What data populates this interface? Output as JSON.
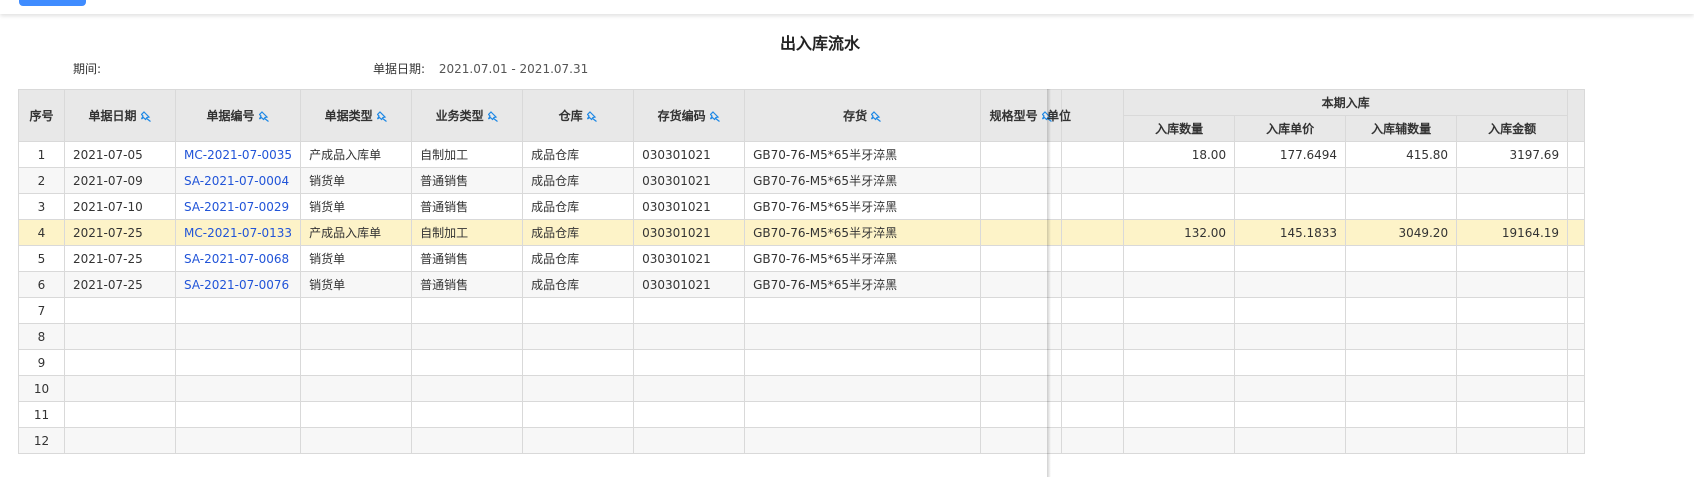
{
  "report": {
    "title": "出入库流水",
    "period_label": "期间:",
    "period_value": "",
    "date_label": "单据日期:",
    "date_value": "2021.07.01 - 2021.07.31"
  },
  "table": {
    "headers": {
      "index": "序号",
      "doc_date": "单据日期",
      "doc_no": "单据编号",
      "doc_type": "单据类型",
      "biz_type": "业务类型",
      "warehouse": "仓库",
      "item_code": "存货编码",
      "item": "存货",
      "spec": "规格型号",
      "unit": "单位",
      "inbound_group": "本期入库",
      "in_qty": "入库数量",
      "in_price": "入库单价",
      "in_aux_qty": "入库辅数量",
      "in_amount": "入库金额"
    },
    "rows": [
      {
        "idx": "1",
        "date": "2021-07-05",
        "no": "MC-2021-07-0035",
        "type": "产成品入库单",
        "biz": "自制加工",
        "wh": "成品仓库",
        "code": "030301021",
        "item": "GB70-76-M5*65半牙淬黑",
        "spec": "",
        "qty": "18.00",
        "price": "177.6494",
        "aux": "415.80",
        "amount": "3197.69"
      },
      {
        "idx": "2",
        "date": "2021-07-09",
        "no": "SA-2021-07-0004",
        "type": "销货单",
        "biz": "普通销售",
        "wh": "成品仓库",
        "code": "030301021",
        "item": "GB70-76-M5*65半牙淬黑",
        "spec": "",
        "qty": "",
        "price": "",
        "aux": "",
        "amount": ""
      },
      {
        "idx": "3",
        "date": "2021-07-10",
        "no": "SA-2021-07-0029",
        "type": "销货单",
        "biz": "普通销售",
        "wh": "成品仓库",
        "code": "030301021",
        "item": "GB70-76-M5*65半牙淬黑",
        "spec": "",
        "qty": "",
        "price": "",
        "aux": "",
        "amount": ""
      },
      {
        "idx": "4",
        "date": "2021-07-25",
        "no": "MC-2021-07-0133",
        "type": "产成品入库单",
        "biz": "自制加工",
        "wh": "成品仓库",
        "code": "030301021",
        "item": "GB70-76-M5*65半牙淬黑",
        "spec": "",
        "qty": "132.00",
        "price": "145.1833",
        "aux": "3049.20",
        "amount": "19164.19"
      },
      {
        "idx": "5",
        "date": "2021-07-25",
        "no": "SA-2021-07-0068",
        "type": "销货单",
        "biz": "普通销售",
        "wh": "成品仓库",
        "code": "030301021",
        "item": "GB70-76-M5*65半牙淬黑",
        "spec": "",
        "qty": "",
        "price": "",
        "aux": "",
        "amount": ""
      },
      {
        "idx": "6",
        "date": "2021-07-25",
        "no": "SA-2021-07-0076",
        "type": "销货单",
        "biz": "普通销售",
        "wh": "成品仓库",
        "code": "030301021",
        "item": "GB70-76-M5*65半牙淬黑",
        "spec": "",
        "qty": "",
        "price": "",
        "aux": "",
        "amount": ""
      },
      {
        "idx": "7",
        "date": "",
        "no": "",
        "type": "",
        "biz": "",
        "wh": "",
        "code": "",
        "item": "",
        "spec": "",
        "qty": "",
        "price": "",
        "aux": "",
        "amount": ""
      },
      {
        "idx": "8",
        "date": "",
        "no": "",
        "type": "",
        "biz": "",
        "wh": "",
        "code": "",
        "item": "",
        "spec": "",
        "qty": "",
        "price": "",
        "aux": "",
        "amount": ""
      },
      {
        "idx": "9",
        "date": "",
        "no": "",
        "type": "",
        "biz": "",
        "wh": "",
        "code": "",
        "item": "",
        "spec": "",
        "qty": "",
        "price": "",
        "aux": "",
        "amount": ""
      },
      {
        "idx": "10",
        "date": "",
        "no": "",
        "type": "",
        "biz": "",
        "wh": "",
        "code": "",
        "item": "",
        "spec": "",
        "qty": "",
        "price": "",
        "aux": "",
        "amount": ""
      },
      {
        "idx": "11",
        "date": "",
        "no": "",
        "type": "",
        "biz": "",
        "wh": "",
        "code": "",
        "item": "",
        "spec": "",
        "qty": "",
        "price": "",
        "aux": "",
        "amount": ""
      },
      {
        "idx": "12",
        "date": "",
        "no": "",
        "type": "",
        "biz": "",
        "wh": "",
        "code": "",
        "item": "",
        "spec": "",
        "qty": "",
        "price": "",
        "aux": "",
        "amount": ""
      }
    ]
  },
  "icons": {
    "sort": "pin-sort-icon"
  },
  "colors": {
    "accent": "#3f8cff",
    "link": "#2154d8",
    "selected_row": "#fdf3c8",
    "sort_icon": "#1e88e5"
  }
}
